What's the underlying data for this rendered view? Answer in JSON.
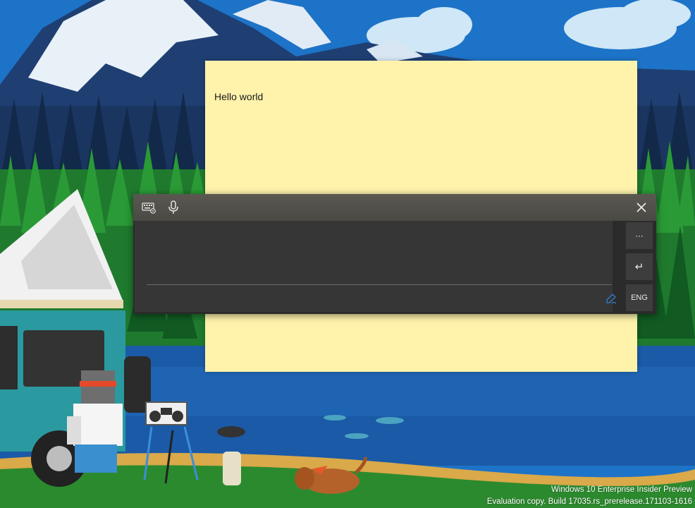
{
  "note": {
    "text": "Hello world",
    "background": "#fff2ab"
  },
  "handwriting_panel": {
    "keyboard_icon": "keyboard-settings-icon",
    "mic_icon": "microphone-icon",
    "close_icon": "close-icon",
    "pen_icon": "pen-icon",
    "more_button": "⋯",
    "enter_button": "↵",
    "language_button": "ENG"
  },
  "watermark": {
    "line1": "Windows 10 Enterprise Insider Preview",
    "line2": "Evaluation copy. Build 17035.rs_prerelease.171103-1616"
  }
}
